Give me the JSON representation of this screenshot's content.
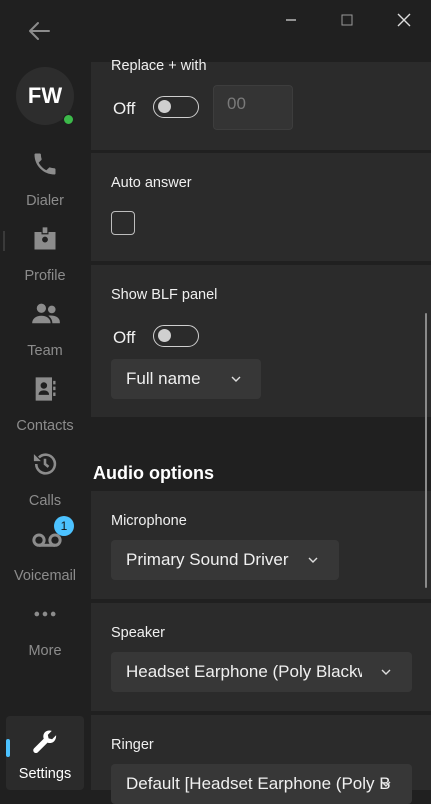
{
  "window": {
    "minimize_icon": "minimize-icon",
    "maximize_icon": "maximize-icon",
    "close_icon": "close-icon"
  },
  "user": {
    "initials": "FW",
    "status_color": "#3cb94a"
  },
  "nav": [
    {
      "label": "Dialer",
      "icon": "phone-icon"
    },
    {
      "label": "Profile",
      "icon": "id-badge-icon"
    },
    {
      "label": "Team",
      "icon": "users-icon"
    },
    {
      "label": "Contacts",
      "icon": "address-book-icon"
    },
    {
      "label": "Calls",
      "icon": "history-icon"
    },
    {
      "label": "Voicemail",
      "icon": "voicemail-icon",
      "badge": "1"
    },
    {
      "label": "More",
      "icon": "more-icon"
    },
    {
      "label": "Settings",
      "icon": "wrench-icon",
      "active": true
    }
  ],
  "settings": {
    "replace_plus": {
      "label": "Replace + with",
      "toggle_label": "Off",
      "value": "00"
    },
    "auto_answer": {
      "label": "Auto answer"
    },
    "blf": {
      "label": "Show BLF panel",
      "toggle_label": "Off",
      "display": "Full name"
    },
    "audio_title": "Audio options",
    "microphone": {
      "label": "Microphone",
      "value": "Primary Sound Driver"
    },
    "speaker": {
      "label": "Speaker",
      "value": "Headset Earphone (Poly Blackwire"
    },
    "ringer": {
      "label": "Ringer",
      "value": "Default [Headset Earphone (Poly Blackwire"
    }
  },
  "colors": {
    "accent": "#4cc2ff",
    "background": "#202020",
    "card": "#2b2b2b"
  }
}
